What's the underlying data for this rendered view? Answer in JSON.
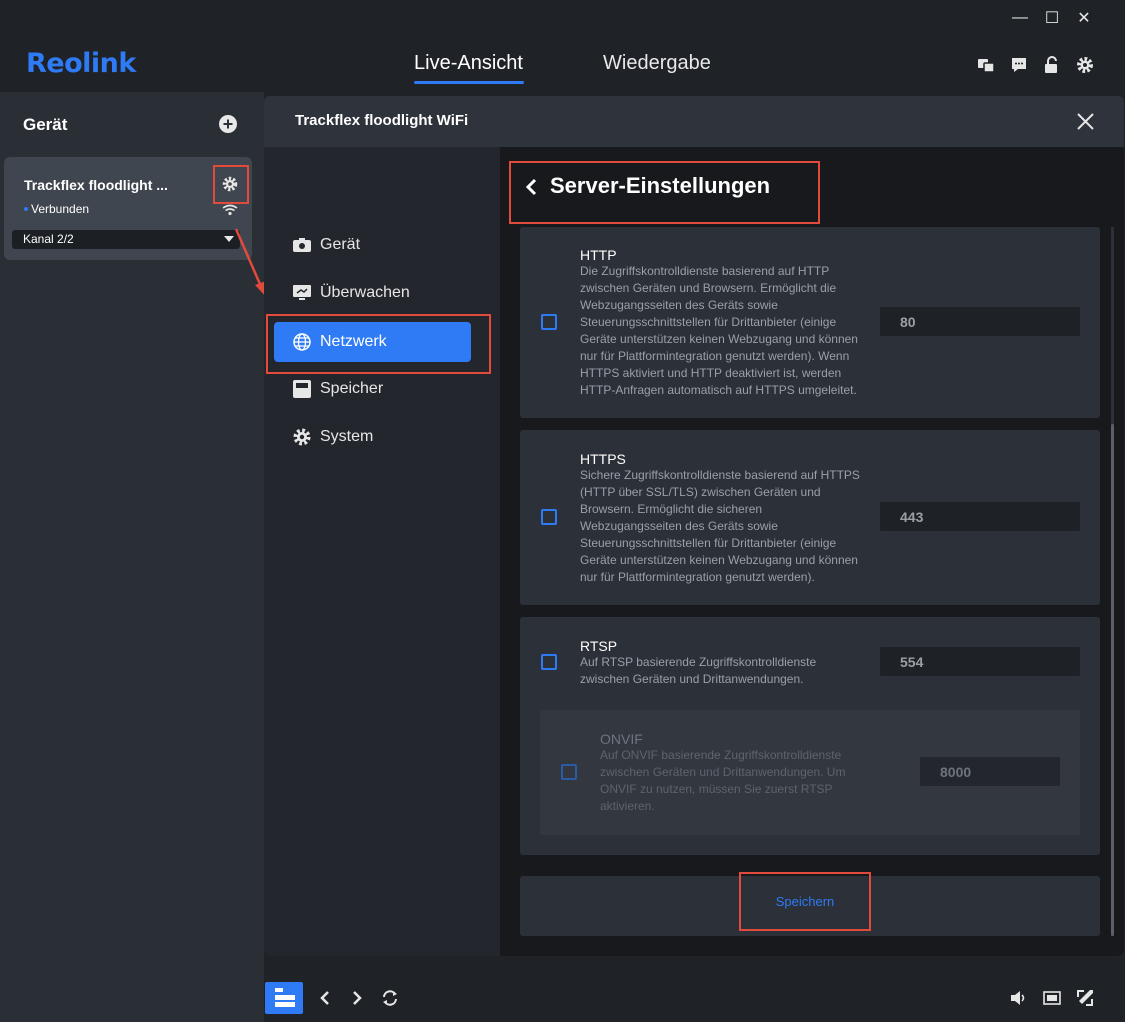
{
  "app": {
    "logo": "Reolink"
  },
  "nav": {
    "tabs": [
      {
        "label": "Live-Ansicht"
      },
      {
        "label": "Wiedergabe"
      }
    ]
  },
  "window": {
    "minimize": "—",
    "maximize": "☐",
    "close": "✕"
  },
  "sidebar": {
    "title": "Gerät",
    "device": {
      "name": "Trackflex floodlight ...",
      "status": "Verbunden",
      "channel": "Kanal 2/2"
    }
  },
  "dialog": {
    "title": "Trackflex floodlight WiFi",
    "menu": [
      {
        "label": "Gerät",
        "icon": "camera-icon"
      },
      {
        "label": "Überwachen",
        "icon": "monitor-icon"
      },
      {
        "label": "Netzwerk",
        "icon": "globe-icon"
      },
      {
        "label": "Speicher",
        "icon": "storage-icon"
      },
      {
        "label": "System",
        "icon": "gear-icon"
      }
    ],
    "page_title": "Server-Einstellungen",
    "services": {
      "http": {
        "name": "HTTP",
        "lines": [
          "Die Zugriffskontrolldienste basierend auf HTTP",
          "zwischen Geräten und Browsern. Ermöglicht die",
          "Webzugangsseiten des Geräts sowie",
          "Steuerungsschnittstellen für Drittanbieter (einige",
          "Geräte unterstützen keinen Webzugang und können",
          "nur für Plattformintegration genutzt werden). Wenn",
          "HTTPS aktiviert und HTTP deaktiviert ist, werden",
          "HTTP-Anfragen automatisch auf HTTPS umgeleitet."
        ],
        "port": "80"
      },
      "https": {
        "name": "HTTPS",
        "lines": [
          "Sichere Zugriffskontrolldienste basierend auf HTTPS",
          "(HTTP über SSL/TLS) zwischen Geräten und",
          "Browsern. Ermöglicht die sicheren",
          "Webzugangsseiten des Geräts sowie",
          "Steuerungsschnittstellen für Drittanbieter (einige",
          "Geräte unterstützen keinen Webzugang und können",
          "nur für Plattformintegration genutzt werden)."
        ],
        "port": "443"
      },
      "rtsp": {
        "name": "RTSP",
        "lines": [
          "Auf RTSP basierende Zugriffskontrolldienste",
          "zwischen Geräten und Drittanwendungen."
        ],
        "port": "554"
      },
      "onvif": {
        "name": "ONVIF",
        "lines": [
          "Auf ONVIF basierende Zugriffskontrolldienste",
          "zwischen Geräten und Drittanwendungen. Um",
          "ONVIF zu nutzen, müssen Sie zuerst RTSP",
          "aktivieren."
        ],
        "port": "8000"
      }
    },
    "save_label": "Speichern"
  },
  "colors": {
    "accent": "#2f7bf5",
    "highlight": "#e24b3c",
    "background": "#1f2227"
  }
}
